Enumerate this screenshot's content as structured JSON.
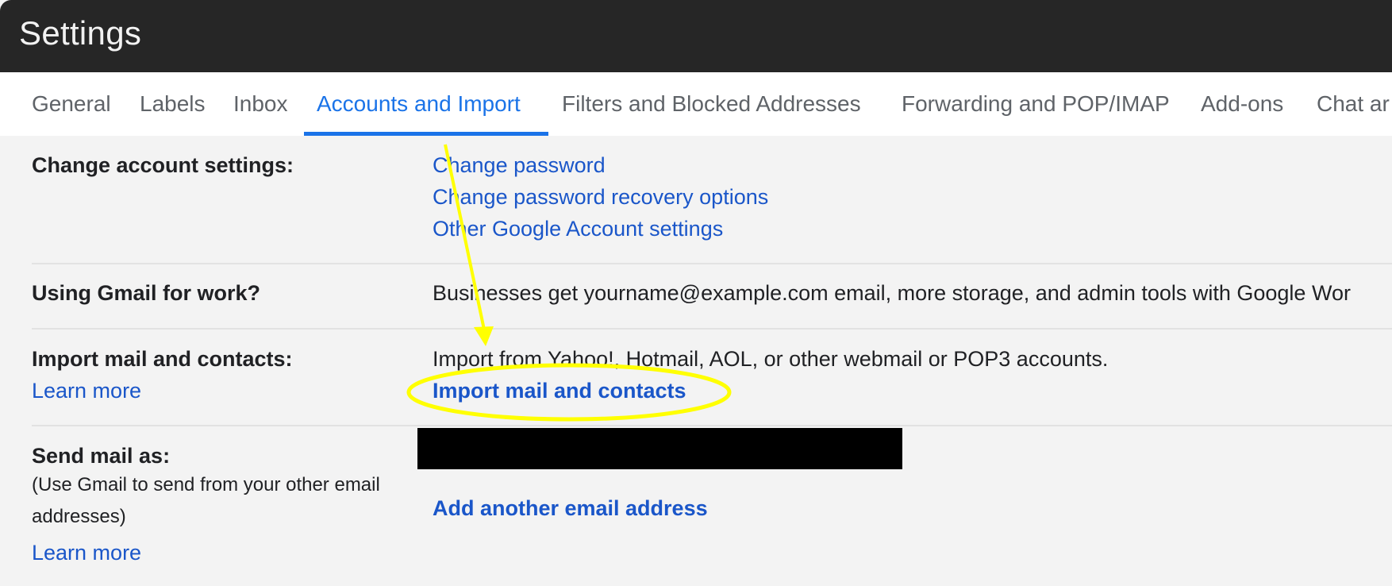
{
  "header": {
    "title": "Settings"
  },
  "tabs": [
    {
      "label": "General",
      "active": false
    },
    {
      "label": "Labels",
      "active": false
    },
    {
      "label": "Inbox",
      "active": false
    },
    {
      "label": "Accounts and Import",
      "active": true
    },
    {
      "label": "Filters and Blocked Addresses",
      "active": false
    },
    {
      "label": "Forwarding and POP/IMAP",
      "active": false
    },
    {
      "label": "Add-ons",
      "active": false
    },
    {
      "label": "Chat ar",
      "active": false
    }
  ],
  "colors": {
    "accent": "#1a73e8",
    "link": "#1a56c9",
    "titlebar": "#262626",
    "annotation": "#ffff00"
  },
  "sections": {
    "change_account": {
      "label": "Change account settings:",
      "links": [
        "Change password",
        "Change password recovery options",
        "Other Google Account settings"
      ]
    },
    "gmail_work": {
      "label": "Using Gmail for work?",
      "text": "Businesses get yourname@example.com email, more storage, and admin tools with Google Wor"
    },
    "import": {
      "label": "Import mail and contacts:",
      "learn_more": "Learn more",
      "description": "Import from Yahoo!, Hotmail, AOL, or other webmail or POP3 accounts.",
      "action": "Import mail and contacts"
    },
    "send_as": {
      "label": "Send mail as:",
      "sublabel": "(Use Gmail to send from your other email addresses)",
      "learn_more": "Learn more",
      "redacted": "[redacted email address]",
      "action": "Add another email address"
    }
  },
  "annotation": {
    "type": "arrow-and-ellipse",
    "target": "Import mail and contacts"
  }
}
